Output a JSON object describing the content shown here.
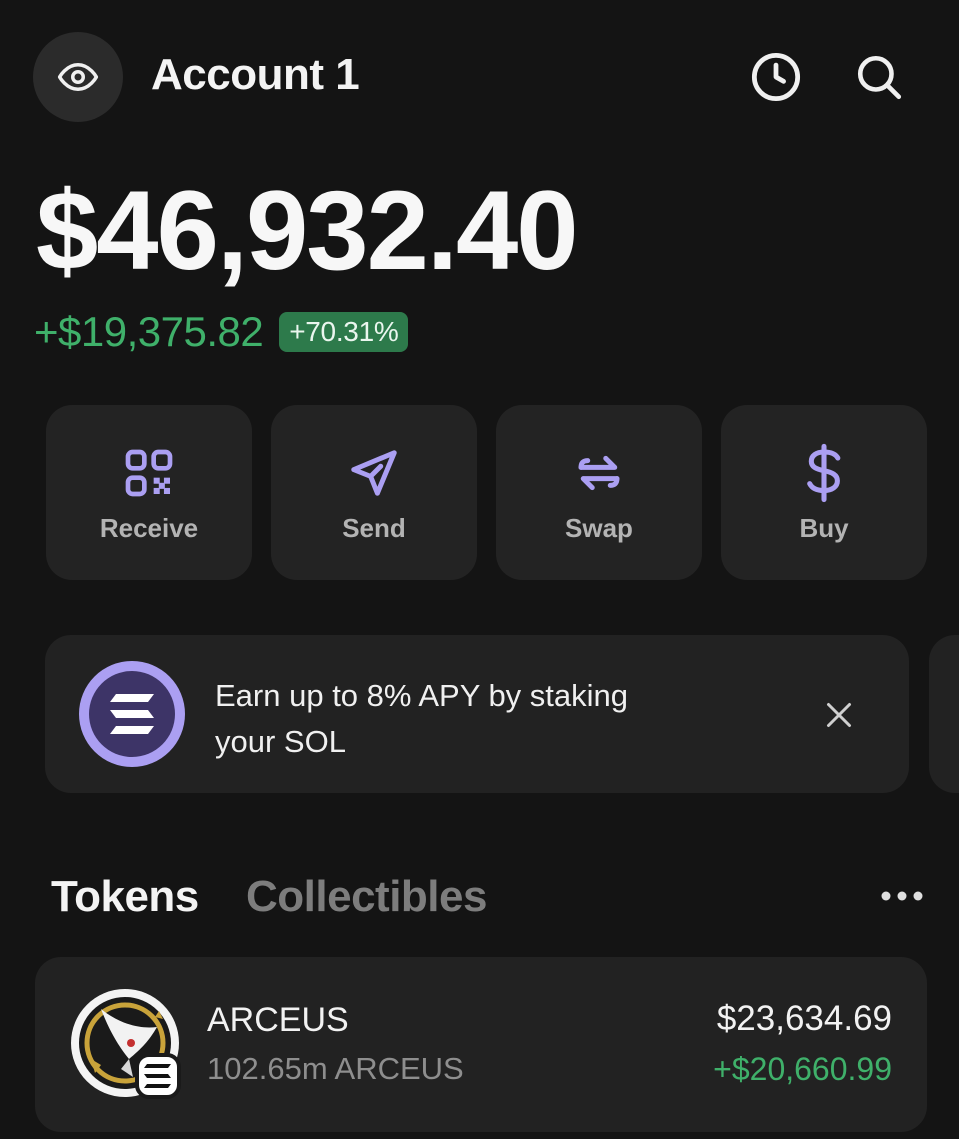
{
  "header": {
    "account_name": "Account 1",
    "icons": [
      "eye-icon",
      "history-icon",
      "search-icon"
    ]
  },
  "balance": {
    "total": "$46,932.40",
    "change_amount": "+$19,375.82",
    "change_percent": "+70.31%"
  },
  "actions": [
    {
      "label": "Receive",
      "icon": "qr-code-icon"
    },
    {
      "label": "Send",
      "icon": "send-icon"
    },
    {
      "label": "Swap",
      "icon": "swap-icon"
    },
    {
      "label": "Buy",
      "icon": "dollar-icon"
    }
  ],
  "promo": {
    "text_line1": "Earn up to 8% APY by staking",
    "text_line2": "your SOL",
    "icon": "solana-icon"
  },
  "tabs": {
    "active": "Tokens",
    "inactive": "Collectibles"
  },
  "tokens": [
    {
      "name": "ARCEUS",
      "amount": "102.65m ARCEUS",
      "value": "$23,634.69",
      "change": "+$20,660.99"
    }
  ],
  "colors": {
    "background": "#141414",
    "card": "#232323",
    "accent_purple": "#ab9ff2",
    "positive_green": "#3fb06a",
    "badge_green": "#2d7a4b",
    "muted_text": "#7d7d7d"
  }
}
